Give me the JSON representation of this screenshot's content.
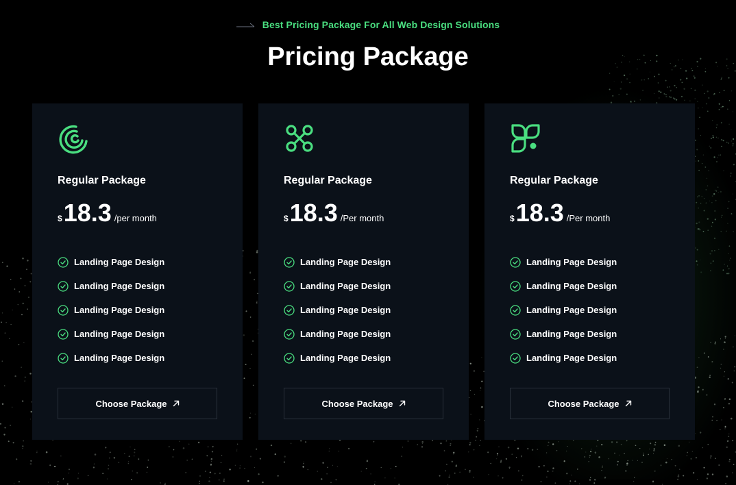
{
  "header": {
    "eyebrow": "Best Pricing Package For All Web Design Solutions",
    "title": "Pricing Package"
  },
  "colors": {
    "accent": "#4ade80",
    "background": "#000000",
    "card_bg": "#0b1119",
    "button_border": "#2a313b"
  },
  "cards": [
    {
      "icon": "concentric-arcs-icon",
      "name": "Regular Package",
      "currency": "$",
      "price": "18.3",
      "period": "/per month",
      "features": [
        "Landing Page Design",
        "Landing Page Design",
        "Landing Page Design",
        "Landing Page Design",
        "Landing Page Design"
      ],
      "button_label": "Choose Package"
    },
    {
      "icon": "four-nodes-icon",
      "name": "Regular Package",
      "currency": "$",
      "price": "18.3",
      "period": "/Per month",
      "features": [
        "Landing Page Design",
        "Landing Page Design",
        "Landing Page Design",
        "Landing Page Design",
        "Landing Page Design"
      ],
      "button_label": "Choose Package"
    },
    {
      "icon": "leaf-shapes-icon",
      "name": "Regular Package",
      "currency": "$",
      "price": "18.3",
      "period": "/Per month",
      "features": [
        "Landing Page Design",
        "Landing Page Design",
        "Landing Page Design",
        "Landing Page Design",
        "Landing Page Design"
      ],
      "button_label": "Choose Package"
    }
  ]
}
